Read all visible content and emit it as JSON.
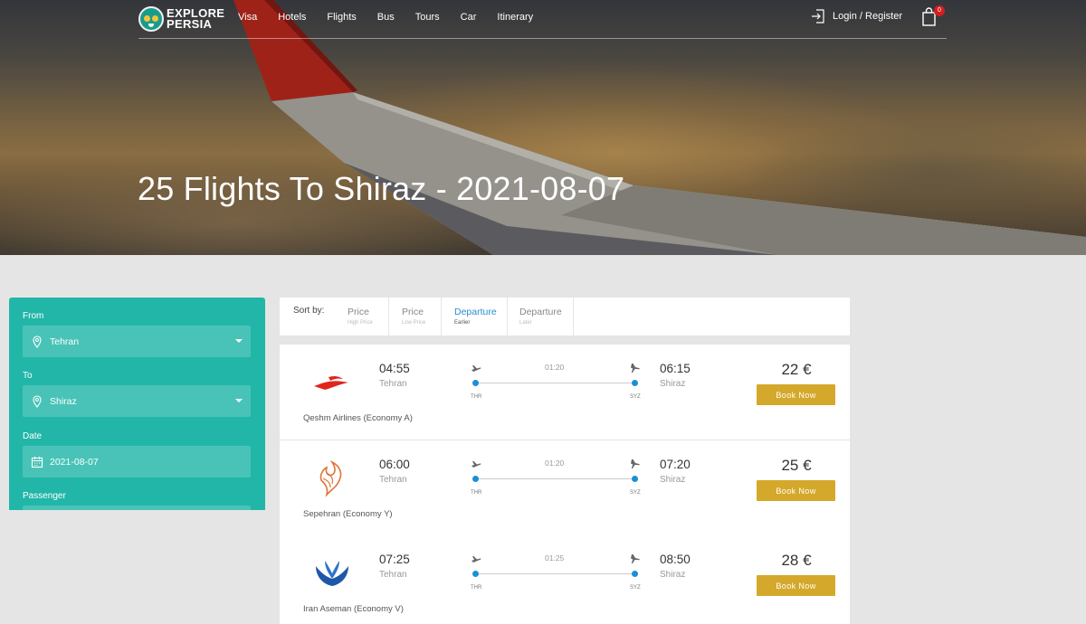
{
  "brand": {
    "line1": "EXPLORE",
    "line2": "PERSIA"
  },
  "nav": [
    "Visa",
    "Hotels",
    "Flights",
    "Bus",
    "Tours",
    "Car",
    "Itinerary"
  ],
  "login_label": "Login / Register",
  "cart_count": "0",
  "page_title": "25 Flights To Shiraz - 2021-08-07",
  "search": {
    "from_label": "From",
    "from_value": "Tehran",
    "to_label": "To",
    "to_value": "Shiraz",
    "date_label": "Date",
    "date_value": "2021-08-07",
    "passenger_label": "Passenger"
  },
  "sort": {
    "label": "Sort by:",
    "options": [
      {
        "title": "Price",
        "sub": "High Price"
      },
      {
        "title": "Price",
        "sub": "Low Price"
      },
      {
        "title": "Departure",
        "sub": "Earlier"
      },
      {
        "title": "Departure",
        "sub": "Later"
      }
    ],
    "active": "Departure (Earlier)"
  },
  "flights": [
    {
      "airline": "Qeshm Airlines (Economy A)",
      "logo": "qeshm-logo-icon",
      "dep_time": "04:55",
      "dep_city": "Tehran",
      "arr_time": "06:15",
      "arr_city": "Shiraz",
      "duration": "01:20",
      "from_code": "THR",
      "to_code": "SYZ",
      "price": "22 €",
      "book_label": "Book Now"
    },
    {
      "airline": "Sepehran (Economy Y)",
      "logo": "sepehran-logo-icon",
      "dep_time": "06:00",
      "dep_city": "Tehran",
      "arr_time": "07:20",
      "arr_city": "Shiraz",
      "duration": "01:20",
      "from_code": "THR",
      "to_code": "SYZ",
      "price": "25 €",
      "book_label": "Book Now"
    },
    {
      "airline": "Iran Aseman (Economy V)",
      "logo": "iran-aseman-logo-icon",
      "dep_time": "07:25",
      "dep_city": "Tehran",
      "arr_time": "08:50",
      "arr_city": "Shiraz",
      "duration": "01:25",
      "from_code": "THR",
      "to_code": "SYZ",
      "price": "28 €",
      "book_label": "Book Now"
    }
  ],
  "colors": {
    "accent": "#21b6a8",
    "book_button": "#d4a82a",
    "link_active": "#2a8ecf",
    "route_dot": "#1a8fd6",
    "cart_badge": "#d21f1f"
  }
}
